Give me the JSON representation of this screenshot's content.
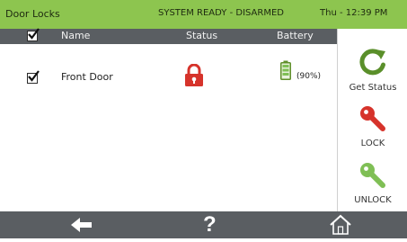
{
  "topbar": {
    "title": "Door Locks",
    "system_status": "SYSTEM READY - DISARMED",
    "clock": "Thu - 12:39 PM"
  },
  "table": {
    "columns": [
      "Name",
      "Status",
      "Battery"
    ],
    "select_all_checked": true,
    "rows": [
      {
        "checked": true,
        "name": "Front Door",
        "status": "locked",
        "status_icon": "padlock-locked-icon",
        "battery": "(90%)",
        "battery_fraction": 0.9
      }
    ]
  },
  "actions": {
    "get_status": "Get Status",
    "lock": "LOCK",
    "unlock": "UNLOCK"
  },
  "nav": {
    "back_icon": "back-arrow-icon",
    "help_glyph": "?",
    "home_icon": "home-icon"
  },
  "colors": {
    "topbar": "#8dc54f",
    "header": "#5a5e62",
    "lock_red": "#d6332b",
    "unlock_green": "#7fbf55",
    "refresh_green": "#5a8f2a"
  }
}
